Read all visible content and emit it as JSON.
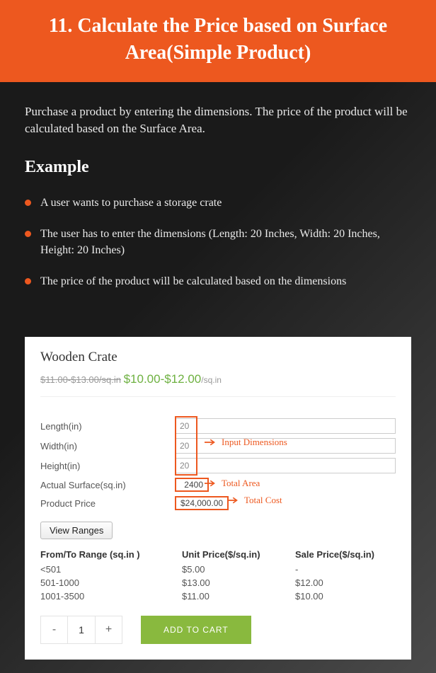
{
  "header": {
    "title": "11. Calculate the Price based on Surface Area(Simple Product)"
  },
  "section": {
    "intro": "Purchase a product by entering the dimensions. The price of the product will be calculated based on the Surface Area.",
    "example_heading": "Example",
    "bullets": [
      "A user wants to purchase a storage crate",
      "The user has to enter the dimensions (Length: 20 Inches, Width: 20 Inches, Height: 20 Inches)",
      "The price of the product will be calculated based on the dimensions"
    ]
  },
  "product": {
    "title": "Wooden Crate",
    "old_price": "$11.00-$13.00/sq.in",
    "new_price": "$10.00-$12.00",
    "new_unit": "/sq.in",
    "fields": {
      "length_label": "Length(in)",
      "length_value": "20",
      "width_label": "Width(in)",
      "width_value": "20",
      "height_label": "Height(in)",
      "height_value": "20",
      "surface_label": "Actual Surface(sq.in)",
      "surface_value": "2400",
      "price_label": "Product Price",
      "price_value": "$24,000.00"
    },
    "annotations": {
      "input_dimensions": "Input Dimensions",
      "total_area": "Total Area",
      "total_cost": "Total Cost"
    },
    "view_ranges": "View Ranges",
    "table": {
      "headers": {
        "range": "From/To Range (sq.in )",
        "unit": "Unit Price($/sq.in)",
        "sale": "Sale Price($/sq.in)"
      },
      "rows": [
        {
          "range": "<501",
          "unit": "$5.00",
          "sale": "-"
        },
        {
          "range": "501-1000",
          "unit": "$13.00",
          "sale": "$12.00"
        },
        {
          "range": "1001-3500",
          "unit": "$11.00",
          "sale": "$10.00"
        }
      ]
    },
    "qty": {
      "minus": "-",
      "value": "1",
      "plus": "+"
    },
    "add_to_cart": "ADD TO CART"
  },
  "colors": {
    "accent": "#ed581f",
    "green_btn": "#89b93e",
    "price_green": "#6eb141"
  }
}
